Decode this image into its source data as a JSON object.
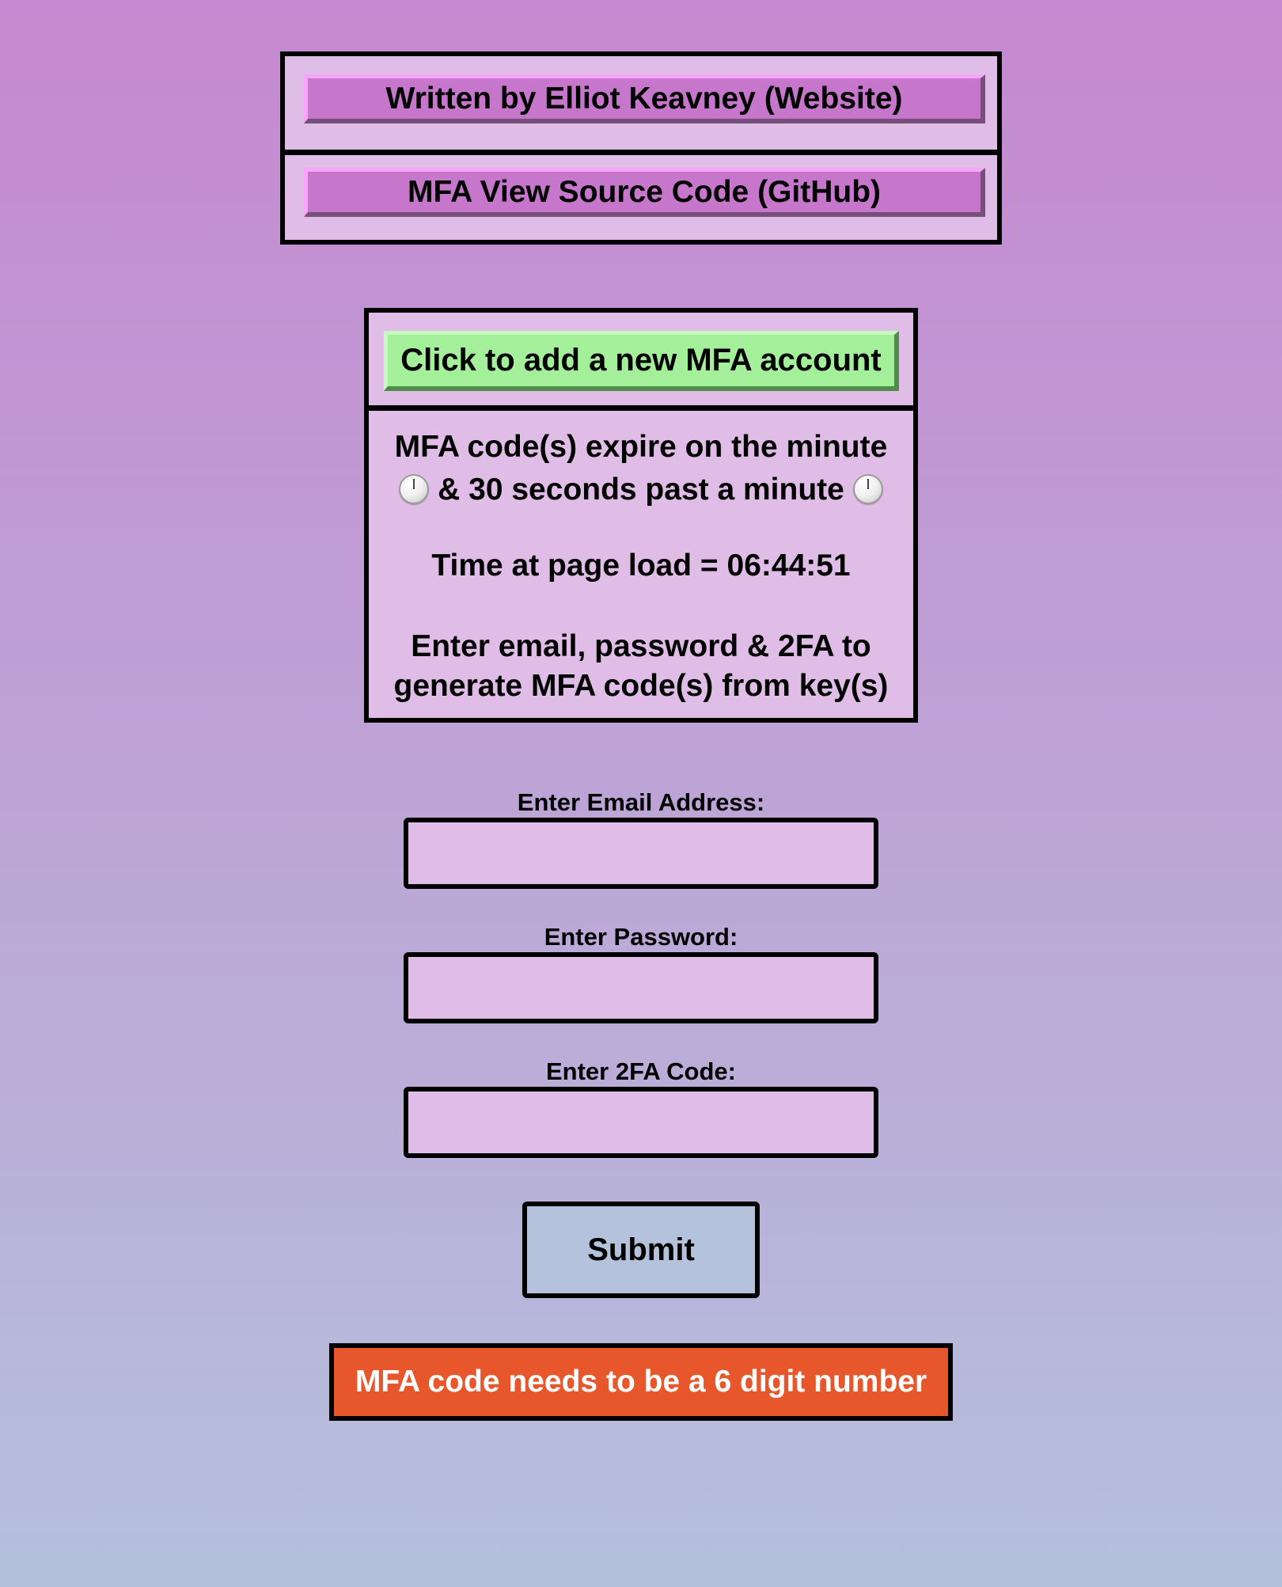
{
  "links": {
    "author_label": "Written by Elliot Keavney (Website)",
    "source_label": "MFA View Source Code (GitHub)"
  },
  "info": {
    "add_account_label": "Click to add a new MFA account",
    "expire_line1": "MFA code(s) expire on the minute",
    "expire_line2": "& 30 seconds past a minute",
    "clock_icon": "clock-icon",
    "load_time_text": "Time at page load = 06:44:51",
    "instruction_line1": "Enter email, password & 2FA to",
    "instruction_line2": "generate MFA code(s) from key(s)"
  },
  "form": {
    "email_label": "Enter Email Address:",
    "email_value": "",
    "password_label": "Enter Password:",
    "password_value": "",
    "twofa_label": "Enter 2FA Code:",
    "twofa_value": "",
    "submit_label": "Submit"
  },
  "error": {
    "message": "MFA code needs to be a 6 digit number"
  },
  "colors": {
    "background_top": "#c688d0",
    "background_bottom": "#b4c0dc",
    "panel": "#e0bde6",
    "link_button": "#c676cb",
    "add_button": "#a4ef9a",
    "submit_button": "#b4c2dc",
    "error": "#e8572b"
  }
}
